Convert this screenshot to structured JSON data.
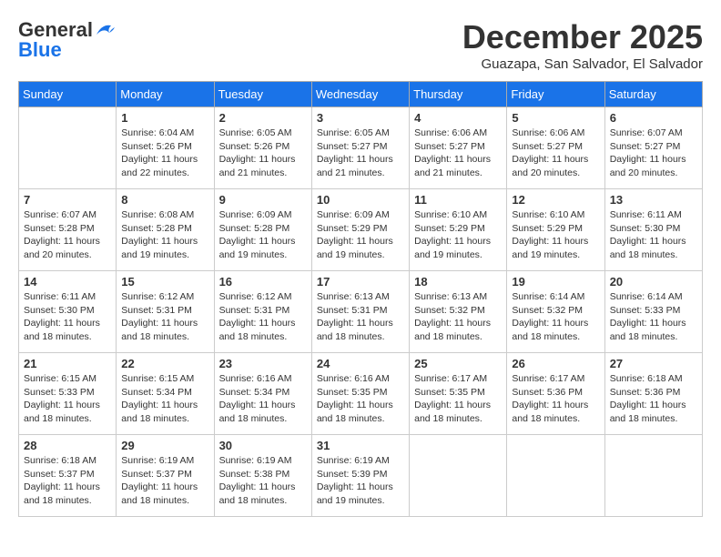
{
  "header": {
    "logo_general": "General",
    "logo_blue": "Blue",
    "month_title": "December 2025",
    "location": "Guazapa, San Salvador, El Salvador"
  },
  "weekdays": [
    "Sunday",
    "Monday",
    "Tuesday",
    "Wednesday",
    "Thursday",
    "Friday",
    "Saturday"
  ],
  "weeks": [
    [
      {
        "day": "",
        "info": ""
      },
      {
        "day": "1",
        "info": "Sunrise: 6:04 AM\nSunset: 5:26 PM\nDaylight: 11 hours\nand 22 minutes."
      },
      {
        "day": "2",
        "info": "Sunrise: 6:05 AM\nSunset: 5:26 PM\nDaylight: 11 hours\nand 21 minutes."
      },
      {
        "day": "3",
        "info": "Sunrise: 6:05 AM\nSunset: 5:27 PM\nDaylight: 11 hours\nand 21 minutes."
      },
      {
        "day": "4",
        "info": "Sunrise: 6:06 AM\nSunset: 5:27 PM\nDaylight: 11 hours\nand 21 minutes."
      },
      {
        "day": "5",
        "info": "Sunrise: 6:06 AM\nSunset: 5:27 PM\nDaylight: 11 hours\nand 20 minutes."
      },
      {
        "day": "6",
        "info": "Sunrise: 6:07 AM\nSunset: 5:27 PM\nDaylight: 11 hours\nand 20 minutes."
      }
    ],
    [
      {
        "day": "7",
        "info": "Sunrise: 6:07 AM\nSunset: 5:28 PM\nDaylight: 11 hours\nand 20 minutes."
      },
      {
        "day": "8",
        "info": "Sunrise: 6:08 AM\nSunset: 5:28 PM\nDaylight: 11 hours\nand 19 minutes."
      },
      {
        "day": "9",
        "info": "Sunrise: 6:09 AM\nSunset: 5:28 PM\nDaylight: 11 hours\nand 19 minutes."
      },
      {
        "day": "10",
        "info": "Sunrise: 6:09 AM\nSunset: 5:29 PM\nDaylight: 11 hours\nand 19 minutes."
      },
      {
        "day": "11",
        "info": "Sunrise: 6:10 AM\nSunset: 5:29 PM\nDaylight: 11 hours\nand 19 minutes."
      },
      {
        "day": "12",
        "info": "Sunrise: 6:10 AM\nSunset: 5:29 PM\nDaylight: 11 hours\nand 19 minutes."
      },
      {
        "day": "13",
        "info": "Sunrise: 6:11 AM\nSunset: 5:30 PM\nDaylight: 11 hours\nand 18 minutes."
      }
    ],
    [
      {
        "day": "14",
        "info": "Sunrise: 6:11 AM\nSunset: 5:30 PM\nDaylight: 11 hours\nand 18 minutes."
      },
      {
        "day": "15",
        "info": "Sunrise: 6:12 AM\nSunset: 5:31 PM\nDaylight: 11 hours\nand 18 minutes."
      },
      {
        "day": "16",
        "info": "Sunrise: 6:12 AM\nSunset: 5:31 PM\nDaylight: 11 hours\nand 18 minutes."
      },
      {
        "day": "17",
        "info": "Sunrise: 6:13 AM\nSunset: 5:31 PM\nDaylight: 11 hours\nand 18 minutes."
      },
      {
        "day": "18",
        "info": "Sunrise: 6:13 AM\nSunset: 5:32 PM\nDaylight: 11 hours\nand 18 minutes."
      },
      {
        "day": "19",
        "info": "Sunrise: 6:14 AM\nSunset: 5:32 PM\nDaylight: 11 hours\nand 18 minutes."
      },
      {
        "day": "20",
        "info": "Sunrise: 6:14 AM\nSunset: 5:33 PM\nDaylight: 11 hours\nand 18 minutes."
      }
    ],
    [
      {
        "day": "21",
        "info": "Sunrise: 6:15 AM\nSunset: 5:33 PM\nDaylight: 11 hours\nand 18 minutes."
      },
      {
        "day": "22",
        "info": "Sunrise: 6:15 AM\nSunset: 5:34 PM\nDaylight: 11 hours\nand 18 minutes."
      },
      {
        "day": "23",
        "info": "Sunrise: 6:16 AM\nSunset: 5:34 PM\nDaylight: 11 hours\nand 18 minutes."
      },
      {
        "day": "24",
        "info": "Sunrise: 6:16 AM\nSunset: 5:35 PM\nDaylight: 11 hours\nand 18 minutes."
      },
      {
        "day": "25",
        "info": "Sunrise: 6:17 AM\nSunset: 5:35 PM\nDaylight: 11 hours\nand 18 minutes."
      },
      {
        "day": "26",
        "info": "Sunrise: 6:17 AM\nSunset: 5:36 PM\nDaylight: 11 hours\nand 18 minutes."
      },
      {
        "day": "27",
        "info": "Sunrise: 6:18 AM\nSunset: 5:36 PM\nDaylight: 11 hours\nand 18 minutes."
      }
    ],
    [
      {
        "day": "28",
        "info": "Sunrise: 6:18 AM\nSunset: 5:37 PM\nDaylight: 11 hours\nand 18 minutes."
      },
      {
        "day": "29",
        "info": "Sunrise: 6:19 AM\nSunset: 5:37 PM\nDaylight: 11 hours\nand 18 minutes."
      },
      {
        "day": "30",
        "info": "Sunrise: 6:19 AM\nSunset: 5:38 PM\nDaylight: 11 hours\nand 18 minutes."
      },
      {
        "day": "31",
        "info": "Sunrise: 6:19 AM\nSunset: 5:39 PM\nDaylight: 11 hours\nand 19 minutes."
      },
      {
        "day": "",
        "info": ""
      },
      {
        "day": "",
        "info": ""
      },
      {
        "day": "",
        "info": ""
      }
    ]
  ]
}
